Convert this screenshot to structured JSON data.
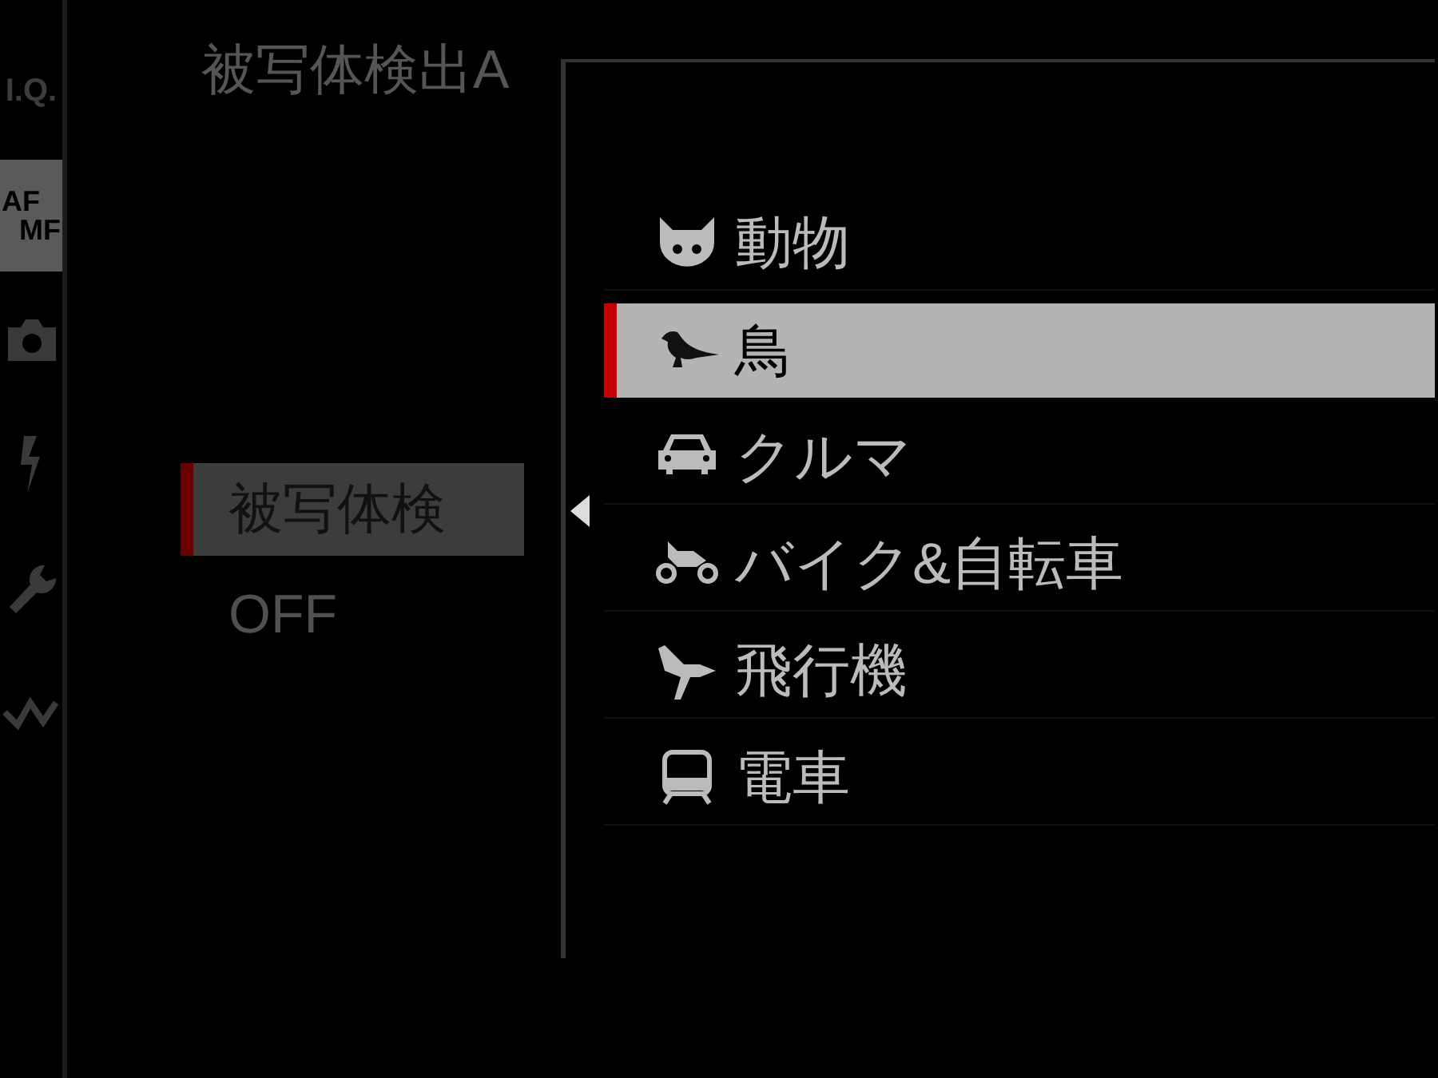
{
  "sidebar": {
    "tabs": [
      {
        "kind": "text",
        "label": "I.Q.",
        "selected": false
      },
      {
        "kind": "af-mf",
        "labels": [
          "AF",
          "MF"
        ],
        "selected": true
      },
      {
        "kind": "camera",
        "selected": false
      },
      {
        "kind": "flash",
        "selected": false
      },
      {
        "kind": "wrench",
        "selected": false
      },
      {
        "kind": "wave",
        "selected": false
      }
    ]
  },
  "title": "被写体検出A",
  "settings": [
    {
      "label": "被写体検",
      "selected": true
    },
    {
      "label": "OFF",
      "selected": false
    }
  ],
  "popup": {
    "items": [
      {
        "kind": "animal",
        "label": "動物",
        "selected": false
      },
      {
        "kind": "bird",
        "label": "鳥",
        "selected": true
      },
      {
        "kind": "car",
        "label": "クルマ",
        "selected": false
      },
      {
        "kind": "motorbike",
        "label": "バイク&自転車",
        "selected": false
      },
      {
        "kind": "airplane",
        "label": "飛行機",
        "selected": false
      },
      {
        "kind": "train",
        "label": "電車",
        "selected": false
      }
    ]
  }
}
